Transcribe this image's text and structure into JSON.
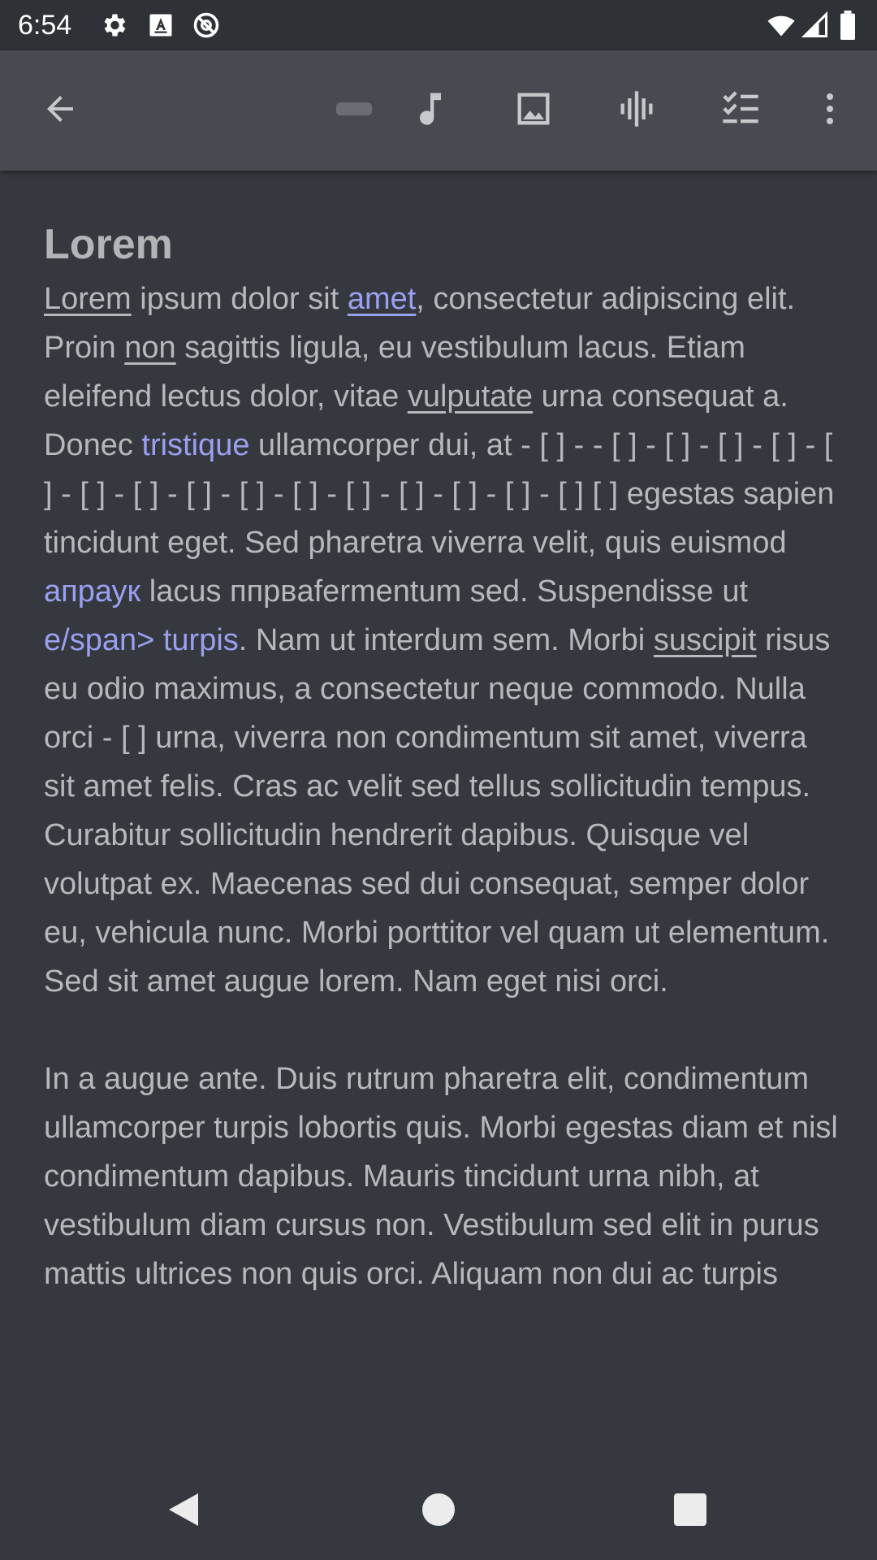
{
  "status_bar": {
    "time": "6:54",
    "icons_left": [
      "gear-icon",
      "text-a-icon",
      "no-sync-icon"
    ],
    "icons_right": [
      "wifi-icon",
      "signal-icon",
      "battery-icon"
    ]
  },
  "toolbar": {
    "icons": [
      "back-arrow-icon",
      "dash-icon",
      "music-note-icon",
      "image-icon",
      "audio-wave-icon",
      "checklist-icon",
      "more-vert-icon"
    ]
  },
  "note": {
    "title": "Lorem",
    "p1": [
      {
        "t": "Lorem",
        "style": "u"
      },
      {
        "t": " ipsum dolor sit ",
        "style": "plain"
      },
      {
        "t": "amet",
        "style": "link-u"
      },
      {
        "t": ", consectetur adipiscing elit. Proin ",
        "style": "plain"
      },
      {
        "t": "non",
        "style": "u"
      },
      {
        "t": " sagittis ligula, eu vestibulum lacus. Etiam eleifend lectus dolor, vitae ",
        "style": "plain"
      },
      {
        "t": "vulputate",
        "style": "u"
      },
      {
        "t": " urna consequat a. Donec ",
        "style": "plain"
      },
      {
        "t": "tristique",
        "style": "link"
      },
      {
        "t": " ullamcorper dui, at - [ ] - - [ ] - [ ] - [ ] - [ ] - [ ] - [ ] - [ ] - [ ] - [ ] - [ ] - [ ] - [ ] - [ ] - [ ] - [ ] [ ] egestas sapien tincidunt eget. Sed pharetra viverra velit, quis euismod ",
        "style": "plain"
      },
      {
        "t": "апраук",
        "style": "link"
      },
      {
        "t": " lacus ппрвafermentum sed. Suspendisse ut ",
        "style": "plain"
      },
      {
        "t": "e/span> turpis",
        "style": "link"
      },
      {
        "t": ". Nam ut interdum sem. Morbi ",
        "style": "plain"
      },
      {
        "t": "suscipit",
        "style": "u"
      },
      {
        "t": " risus eu odio maximus, a consectetur neque commodo. Nulla orci - [ ] urna, viverra non condimentum sit amet, viverra sit amet felis. Cras ac velit sed tellus sollicitudin tempus. Curabitur sollicitudin hendrerit dapibus. Quisque vel volutpat ex. Maecenas sed dui consequat, semper dolor eu, vehicula nunc. Morbi porttitor vel quam ut elementum. Sed sit amet augue lorem. Nam eget nisi orci.",
        "style": "plain"
      }
    ],
    "p2": "In a augue ante. Duis rutrum pharetra elit, condimentum ullamcorper turpis lobortis quis. Morbi egestas diam et nisl condimentum dapibus. Mauris tincidunt urna nibh, at vestibulum diam cursus non. Vestibulum sed elit in purus mattis ultrices non quis orci. Aliquam non dui ac turpis"
  },
  "nav_bar": {
    "icons": [
      "nav-back-icon",
      "nav-home-icon",
      "nav-recents-icon"
    ]
  },
  "colors": {
    "background": "#35383e",
    "toolbar": "#474a50",
    "status_bar": "#2e3136",
    "text": "#b7b8bc",
    "link": "#9aa0ef"
  }
}
